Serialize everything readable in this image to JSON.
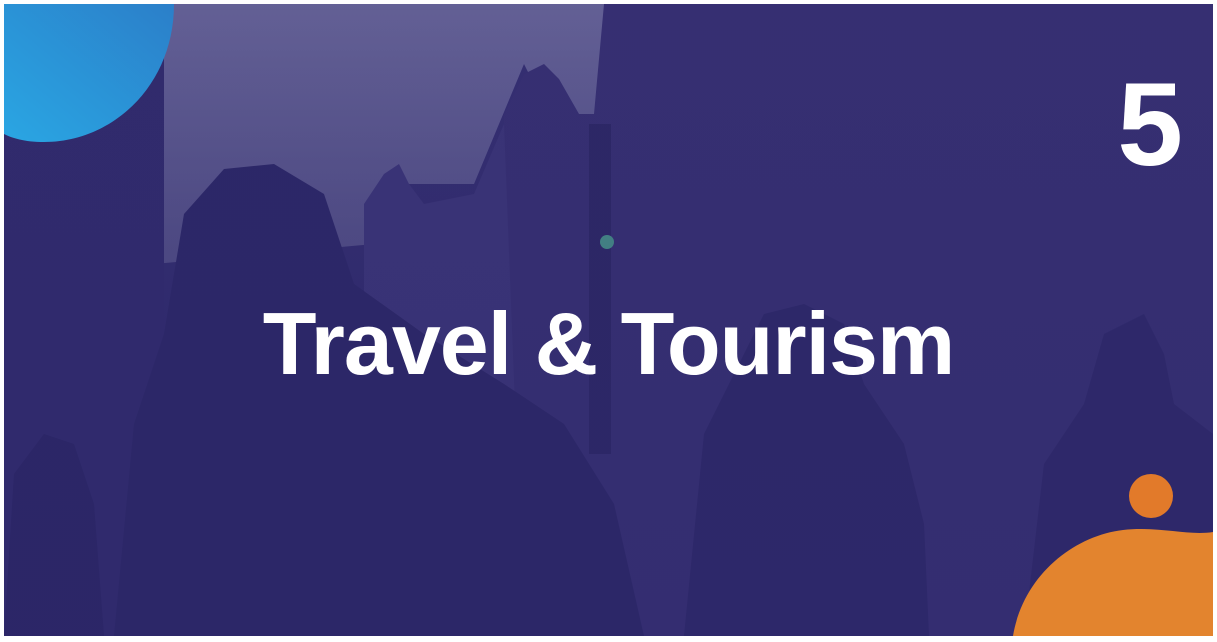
{
  "slide": {
    "number": "5",
    "title": "Travel & Tourism"
  },
  "colors": {
    "overlay": "#3b3577",
    "accent_blue": "#2fa3e0",
    "accent_orange": "#e47d2c",
    "text": "#ffffff"
  },
  "icons": {
    "corner_top_left": "blue-blob-shape",
    "corner_bottom_right": "orange-blob-shape"
  }
}
